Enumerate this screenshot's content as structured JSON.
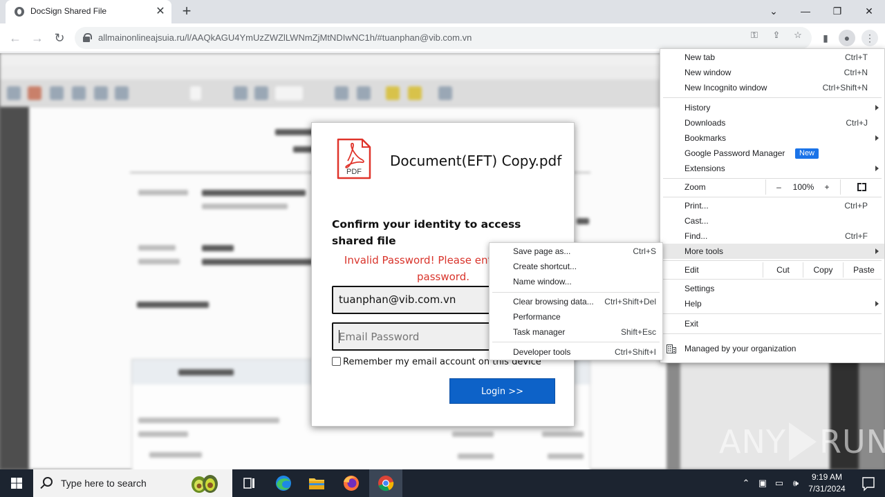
{
  "browser": {
    "tab_title": "DocSign Shared File",
    "url": "allmainonlineajsuia.ru/l/AAQkAGU4YmUzZWZlLWNmZjMtNDIwNC1h/#tuanphan@vib.com.vn"
  },
  "dialog": {
    "file_icon_label": "PDF",
    "document_name": "Document(EFT) Copy.pdf",
    "heading": "Confirm your identity to access shared file",
    "error": "Invalid Password! Please enter correct password.",
    "email_value": "tuanphan@vib.com.vn",
    "password_placeholder": "Email Password",
    "remember_label": "Remember my email account on this device",
    "login_label": "Login >>"
  },
  "chrome_menu": {
    "new_tab": {
      "label": "New tab",
      "shortcut": "Ctrl+T"
    },
    "new_window": {
      "label": "New window",
      "shortcut": "Ctrl+N"
    },
    "new_incognito": {
      "label": "New Incognito window",
      "shortcut": "Ctrl+Shift+N"
    },
    "history": {
      "label": "History"
    },
    "downloads": {
      "label": "Downloads",
      "shortcut": "Ctrl+J"
    },
    "bookmarks": {
      "label": "Bookmarks"
    },
    "password_manager": {
      "label": "Google Password Manager",
      "badge": "New"
    },
    "extensions": {
      "label": "Extensions"
    },
    "zoom": {
      "label": "Zoom",
      "minus": "–",
      "value": "100%",
      "plus": "+"
    },
    "print": {
      "label": "Print...",
      "shortcut": "Ctrl+P"
    },
    "cast": {
      "label": "Cast..."
    },
    "find": {
      "label": "Find...",
      "shortcut": "Ctrl+F"
    },
    "more_tools": {
      "label": "More tools"
    },
    "edit": {
      "label": "Edit",
      "cut": "Cut",
      "copy": "Copy",
      "paste": "Paste"
    },
    "settings": {
      "label": "Settings"
    },
    "help": {
      "label": "Help"
    },
    "exit": {
      "label": "Exit"
    },
    "managed": {
      "label": "Managed by your organization"
    }
  },
  "more_tools_menu": {
    "save_page": {
      "label": "Save page as...",
      "shortcut": "Ctrl+S"
    },
    "create_shortcut": {
      "label": "Create shortcut..."
    },
    "name_window": {
      "label": "Name window..."
    },
    "clear_browsing": {
      "label": "Clear browsing data...",
      "shortcut": "Ctrl+Shift+Del"
    },
    "performance": {
      "label": "Performance"
    },
    "task_manager": {
      "label": "Task manager",
      "shortcut": "Shift+Esc"
    },
    "developer_tools": {
      "label": "Developer tools",
      "shortcut": "Ctrl+Shift+I"
    }
  },
  "watermark": {
    "left": "ANY",
    "right": "RUN"
  },
  "taskbar": {
    "search_placeholder": "Type here to search",
    "time": "9:19 AM",
    "date": "7/31/2024"
  },
  "colors": {
    "login_button": "#0d62c8",
    "error_text": "#d9342b",
    "pdf_icon": "#e0342b",
    "new_badge": "#1a73e8",
    "taskbar": "#1c2430"
  }
}
